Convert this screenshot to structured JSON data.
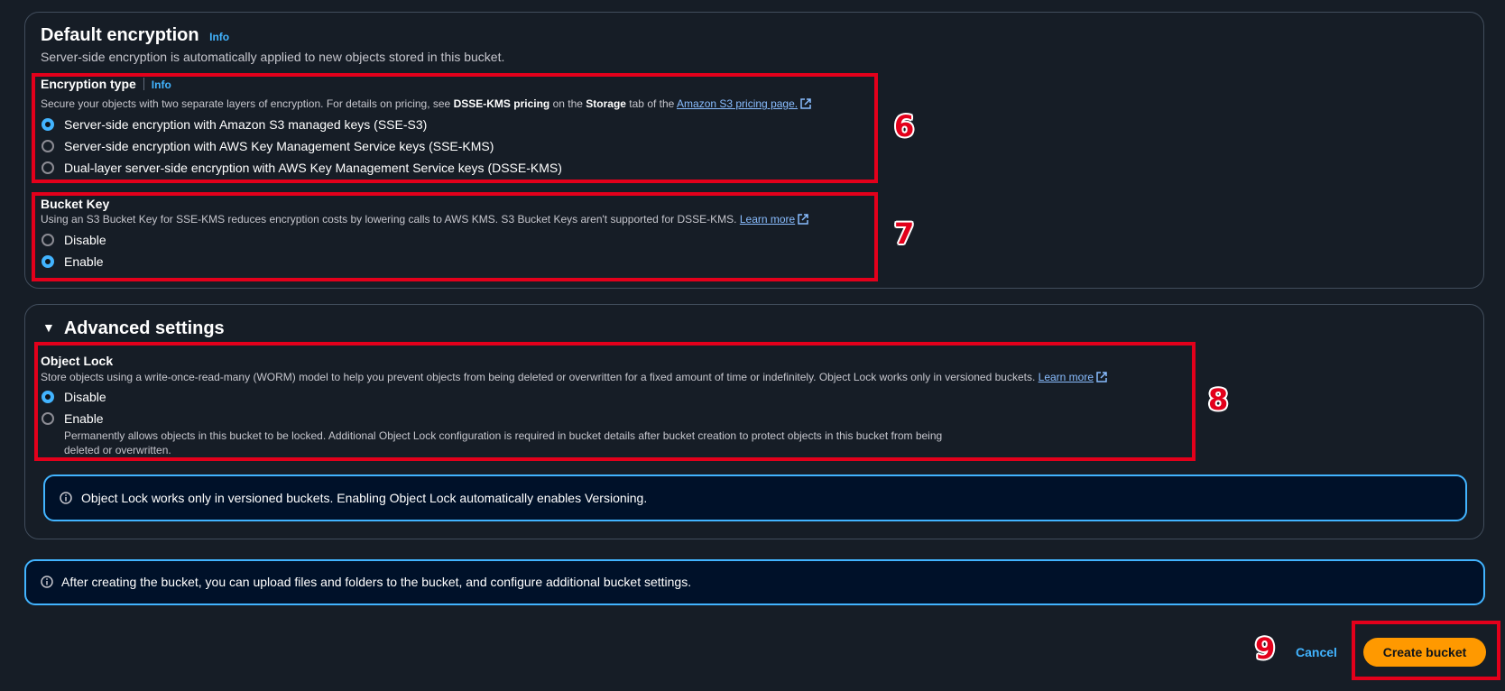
{
  "encryption_section": {
    "title": "Default encryption",
    "info": "Info",
    "description": "Server-side encryption is automatically applied to new objects stored in this bucket.",
    "encryption_type": {
      "label": "Encryption type",
      "info": "Info",
      "desc_pre": "Secure your objects with two separate layers of encryption. For details on pricing, see ",
      "desc_bold1": "DSSE-KMS pricing",
      "desc_mid": " on the ",
      "desc_bold2": "Storage",
      "desc_post": " tab of the ",
      "desc_link": "Amazon S3 pricing page.",
      "options": [
        {
          "label": "Server-side encryption with Amazon S3 managed keys (SSE-S3)",
          "selected": true
        },
        {
          "label": "Server-side encryption with AWS Key Management Service keys (SSE-KMS)",
          "selected": false
        },
        {
          "label": "Dual-layer server-side encryption with AWS Key Management Service keys (DSSE-KMS)",
          "selected": false
        }
      ]
    },
    "bucket_key": {
      "label": "Bucket Key",
      "desc": "Using an S3 Bucket Key for SSE-KMS reduces encryption costs by lowering calls to AWS KMS. S3 Bucket Keys aren't supported for DSSE-KMS.",
      "learn_more": "Learn more",
      "options": [
        {
          "label": "Disable",
          "selected": false
        },
        {
          "label": "Enable",
          "selected": true
        }
      ]
    }
  },
  "advanced_section": {
    "title": "Advanced settings",
    "object_lock": {
      "label": "Object Lock",
      "desc": "Store objects using a write-once-read-many (WORM) model to help you prevent objects from being deleted or overwritten for a fixed amount of time or indefinitely. Object Lock works only in versioned buckets.",
      "learn_more": "Learn more",
      "options": [
        {
          "label": "Disable",
          "selected": true
        },
        {
          "label": "Enable",
          "selected": false
        }
      ],
      "enable_desc_line1": "Permanently allows objects in this bucket to be locked. Additional Object Lock configuration is required in bucket details after bucket creation to protect objects in this bucket from being",
      "enable_desc_line2": "deleted or overwritten."
    },
    "alert": "Object Lock works only in versioned buckets. Enabling Object Lock automatically enables Versioning."
  },
  "footer_alert": "After creating the bucket, you can upload files and folders to the bucket, and configure additional bucket settings.",
  "actions": {
    "cancel": "Cancel",
    "create": "Create bucket"
  },
  "annotations": [
    "6",
    "7",
    "8",
    "9"
  ],
  "colors": {
    "background": "#161d26",
    "accent": "#42b4ff",
    "primary_button": "#ff9900",
    "annotation_red": "#e3001b"
  }
}
